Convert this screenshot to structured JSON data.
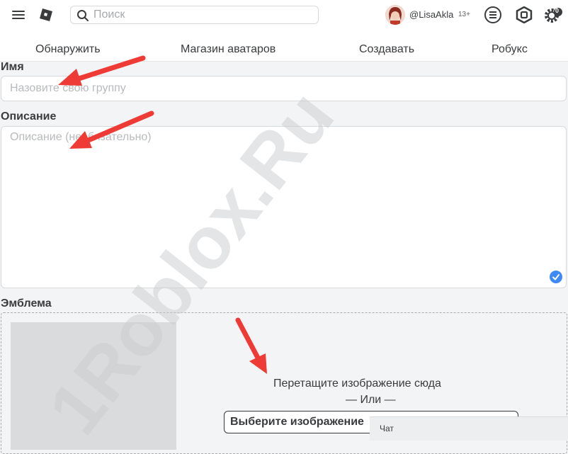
{
  "header": {
    "search": {
      "placeholder": "Поиск"
    },
    "user": {
      "name": "@LisaAkla",
      "age_badge": "13+"
    },
    "robux_count": "0"
  },
  "nav": {
    "items": [
      {
        "label": "Обнаружить"
      },
      {
        "label": "Магазин аватаров"
      },
      {
        "label": "Создавать"
      },
      {
        "label": "Робукс"
      }
    ]
  },
  "form": {
    "name": {
      "label": "Имя",
      "placeholder": "Назовите свою группу"
    },
    "description": {
      "label": "Описание",
      "placeholder": "Описание (необязательно)"
    },
    "emblem": {
      "label": "Эмблема",
      "drop_text": "Перетащите изображение сюда",
      "or_text": "— Или —",
      "choose_button": "Выберите изображение"
    }
  },
  "chat": {
    "label": "Чат"
  },
  "watermark": {
    "text": "1Roblox.Ru"
  },
  "icons": {
    "menu": "hamburger-menu-icon",
    "logo": "roblox-logo-icon",
    "search": "search-icon",
    "notifications": "notifications-list-icon",
    "robux": "robux-icon",
    "settings": "settings-gear-icon",
    "check": "checkmark-icon"
  },
  "colors": {
    "accent_blue": "#3d8af7",
    "arrow_red": "#ee3b36",
    "watermark": "#c9cbcd"
  }
}
